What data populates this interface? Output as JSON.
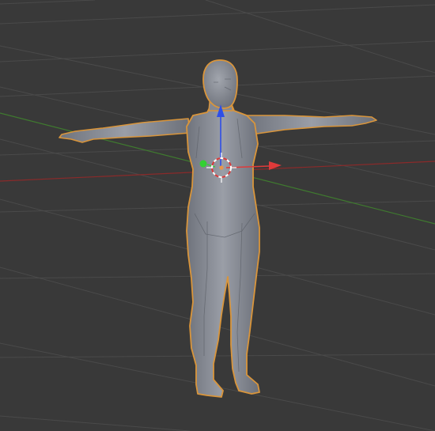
{
  "viewport": {
    "background": "#393939",
    "grid_color": "#4a4a4a",
    "x_axis_color": "#8a2a2a",
    "y_axis_color": "#3f7a2f",
    "selection_outline_color": "#d9953b",
    "mesh_color": "#8b8f99",
    "mode": "object-mode",
    "selected_object": "human-figure-mesh"
  },
  "gizmo": {
    "x_arrow_color": "#e03a3a",
    "y_handle_color": "#33d033",
    "z_arrow_color": "#2f4fe8",
    "cursor_icon": "3d-cursor-icon"
  }
}
